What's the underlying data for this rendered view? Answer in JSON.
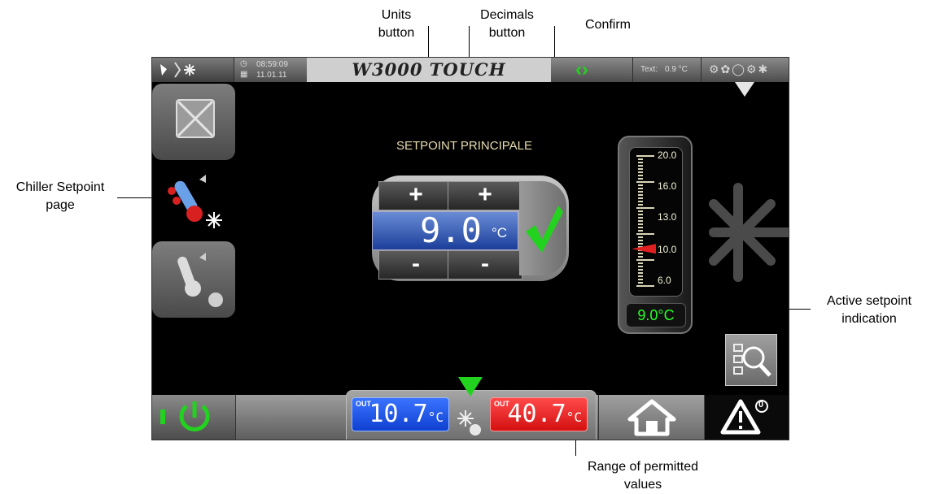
{
  "callouts": {
    "units_button": "Units\nbutton",
    "decimals_button": "Decimals\nbutton",
    "confirm": "Confirm",
    "chiller_setpoint_page": "Chiller Setpoint\npage",
    "active_setpoint_indication": "Active setpoint\nindication",
    "range_of_permitted_values": "Range of permitted\nvalues"
  },
  "topbar": {
    "time": "08:59:09",
    "date": "11.01.11",
    "brand": "W3000 TOUCH",
    "text_label": "Text:",
    "text_value": "0.9 °C"
  },
  "setpoint": {
    "title": "SETPOINT PRINCIPALE",
    "plus_label": "+",
    "minus_label": "-",
    "value": "9.0",
    "unit": "°C"
  },
  "gauge": {
    "ticks": [
      "20.0",
      "16.0",
      "13.0",
      "10.0",
      "6.0"
    ],
    "active_value": "9.0°C",
    "pointer_value": 10.0,
    "range": [
      6.0,
      20.0
    ]
  },
  "bottombar": {
    "out_label": "OUT",
    "out_left_value": "10.7",
    "out_left_unit": "°C",
    "out_right_value": "40.7",
    "out_right_unit": "°C",
    "alarm_count": "0"
  },
  "colors": {
    "accent_green": "#23d21f",
    "value_blue": "#1e4fb8",
    "out_blue": "#1c5cff",
    "out_red": "#ff1e1e",
    "label_cream": "#e8dcb0"
  }
}
